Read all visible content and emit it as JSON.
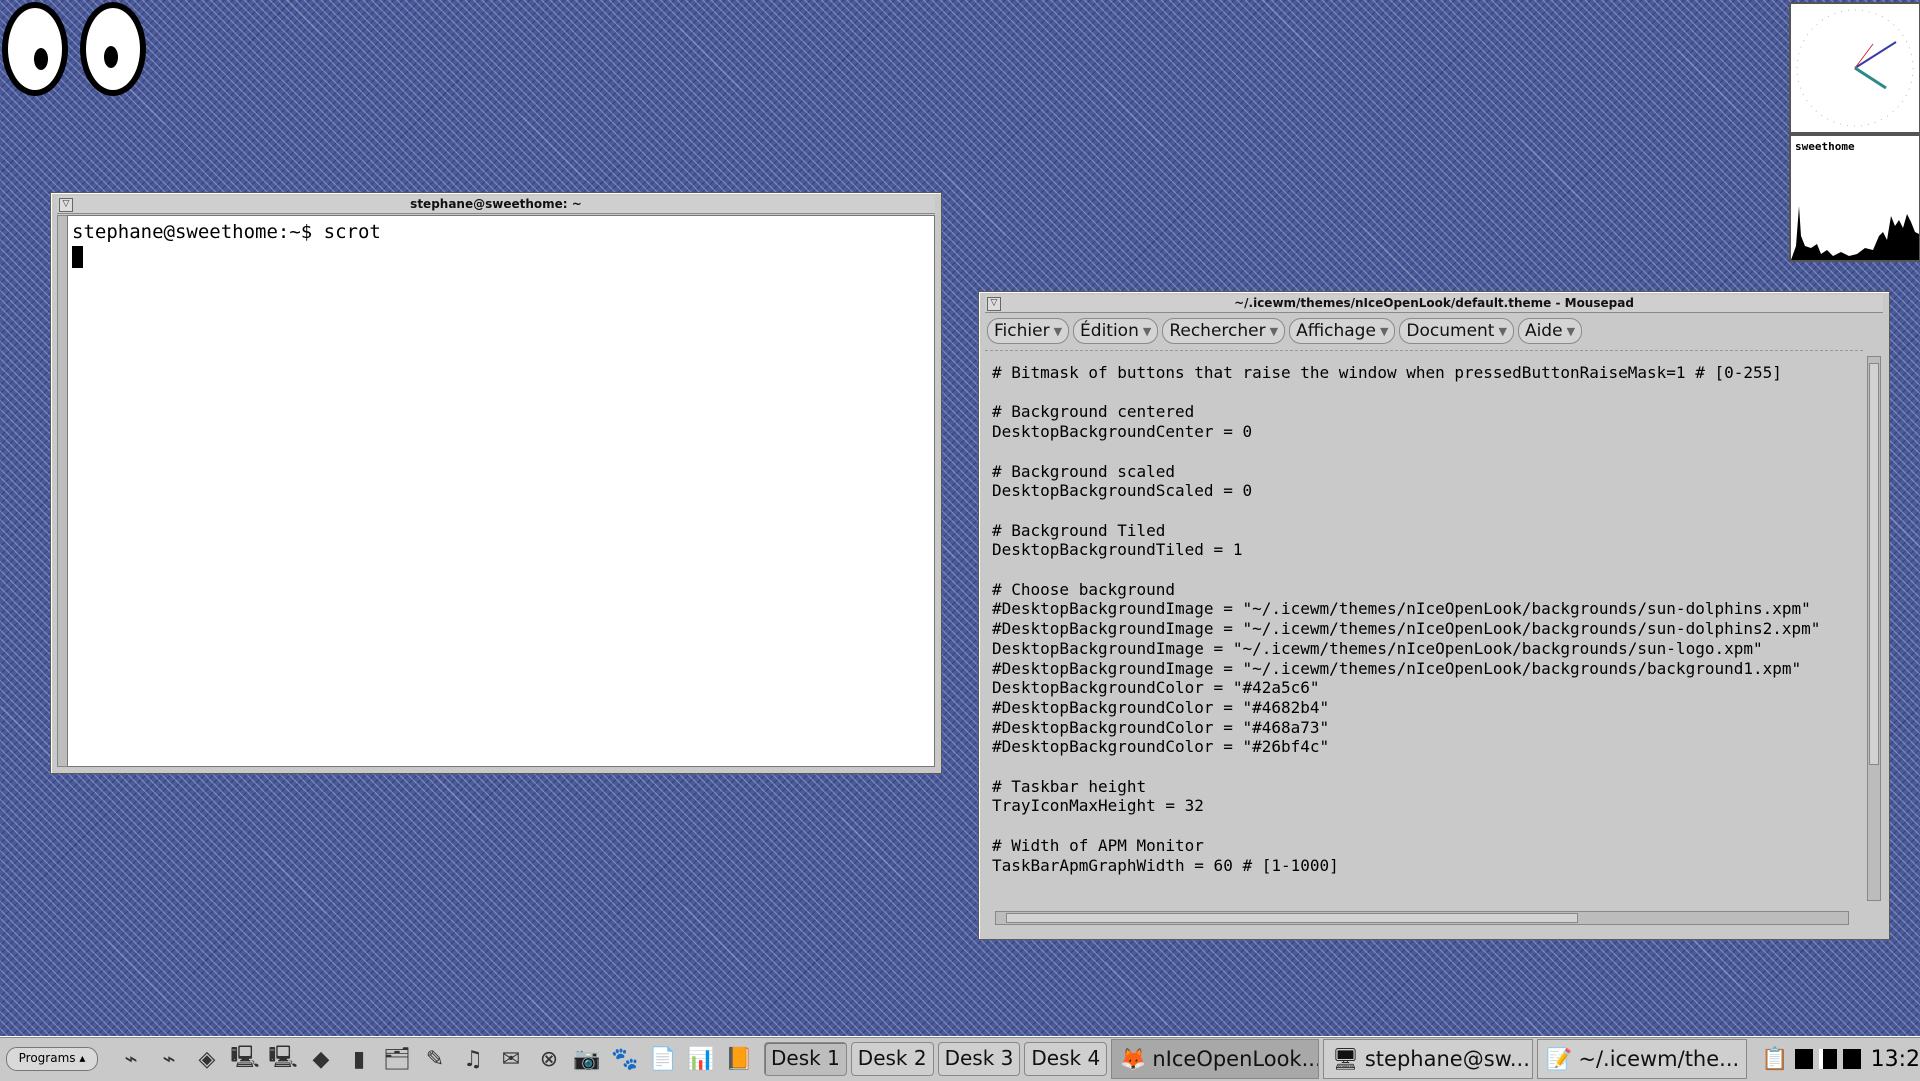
{
  "terminal": {
    "title": "stephane@sweethome: ~",
    "lines": [
      "stephane@sweethome:~$ scrot"
    ]
  },
  "mousepad": {
    "title": "~/.icewm/themes/nIceOpenLook/default.theme - Mousepad",
    "menus": [
      "Fichier",
      "Édition",
      "Rechercher",
      "Affichage",
      "Document",
      "Aide"
    ],
    "content": "# Bitmask of buttons that raise the window when pressedButtonRaiseMask=1 # [0-255]\n\n# Background centered\nDesktopBackgroundCenter = 0\n\n# Background scaled\nDesktopBackgroundScaled = 0\n\n# Background Tiled\nDesktopBackgroundTiled = 1\n\n# Choose background\n#DesktopBackgroundImage = \"~/.icewm/themes/nIceOpenLook/backgrounds/sun-dolphins.xpm\"\n#DesktopBackgroundImage = \"~/.icewm/themes/nIceOpenLook/backgrounds/sun-dolphins2.xpm\"\nDesktopBackgroundImage = \"~/.icewm/themes/nIceOpenLook/backgrounds/sun-logo.xpm\"\n#DesktopBackgroundImage = \"~/.icewm/themes/nIceOpenLook/backgrounds/background1.xpm\"\nDesktopBackgroundColor = \"#42a5c6\"\n#DesktopBackgroundColor = \"#4682b4\"\n#DesktopBackgroundColor = \"#468a73\"\n#DesktopBackgroundColor = \"#26bf4c\"\n\n# Taskbar height\nTrayIconMaxHeight = 32\n\n# Width of APM Monitor\nTaskBarApmGraphWidth = 60 # [1-1000]"
  },
  "monitor": {
    "label": "sweethome"
  },
  "taskbar": {
    "programs": "Programs",
    "desks": [
      "Desk 1",
      "Desk 2",
      "Desk 3",
      "Desk 4"
    ],
    "active_desk": 0,
    "tasks": [
      {
        "label": "nIceOpenLook...",
        "icon": "firefox-icon",
        "glyph": "🦊"
      },
      {
        "label": "stephane@sw...",
        "icon": "terminal-icon",
        "glyph": "🖥"
      },
      {
        "label": "~/.icewm/the...",
        "icon": "text-editor-icon",
        "glyph": "📝"
      }
    ],
    "clock": "13:2"
  },
  "colors": {
    "desktop": "#4a5a9a",
    "window": "#c9c9c9",
    "active_task": "#a8a8a8"
  }
}
